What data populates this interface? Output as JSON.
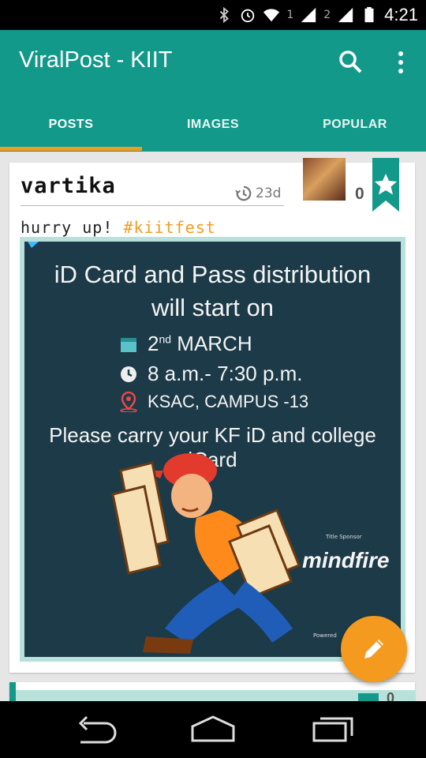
{
  "status_bar": {
    "time": "4:21",
    "sim1_label": "1",
    "sim2_label": "2",
    "icons": [
      "bluetooth-icon",
      "alarm-icon",
      "wifi-icon",
      "signal-icon",
      "battery-icon"
    ]
  },
  "app_bar": {
    "title": "ViralPost - KIIT",
    "icons": [
      "search-icon",
      "more-vert-icon"
    ],
    "tabs": [
      {
        "label": "POSTS",
        "active": true
      },
      {
        "label": "IMAGES",
        "active": false
      },
      {
        "label": "POPULAR",
        "active": false
      }
    ],
    "colors": {
      "primary": "#13998a",
      "accent": "#f39a1f"
    }
  },
  "post": {
    "author": "vartika",
    "age": "23d",
    "score": "0",
    "caption_text": "hurry up! ",
    "hashtag": "#kiitfest",
    "poster": {
      "line1": "iD Card and Pass distribution",
      "line2": "will start on",
      "date_prefix": "2",
      "date_suffix": "nd",
      "date_month": "MARCH",
      "time": "8 a.m.- 7:30 p.m.",
      "venue": "KSAC, CAMPUS -13",
      "note": "Please carry your KF iD and college iCard",
      "title_sponsor_label": "Title Sponsor",
      "sponsor": "mindfire",
      "powered_label": "Powered"
    }
  },
  "next_post": {
    "score": "0"
  },
  "fab": {
    "icon": "pencil-icon"
  },
  "nav_bar": {
    "icons": [
      "back-icon",
      "home-icon",
      "recents-icon"
    ]
  }
}
